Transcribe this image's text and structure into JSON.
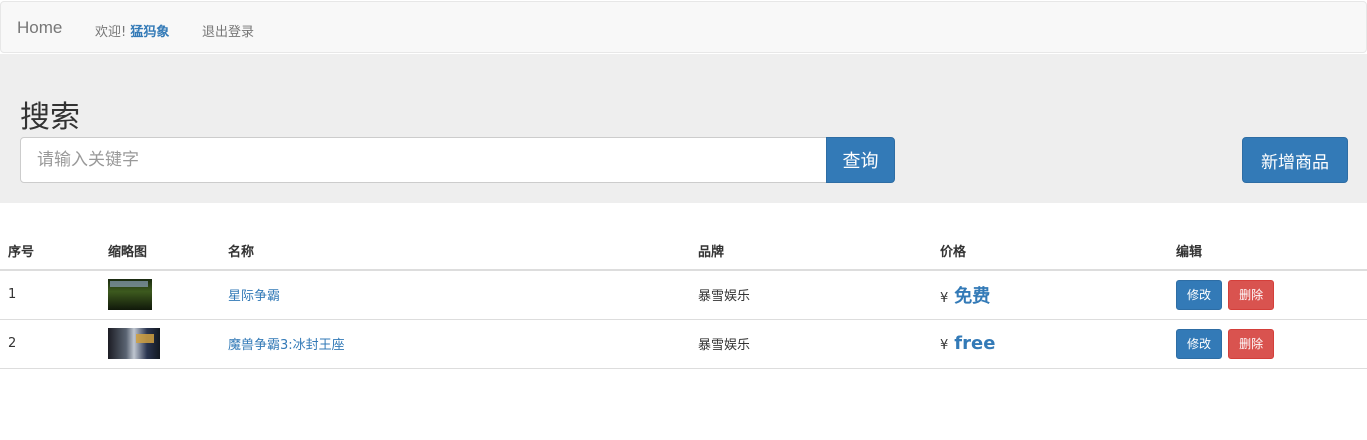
{
  "nav": {
    "brand": "Home",
    "welcome_prefix": "欢迎!",
    "username": "猛犸象",
    "logout": "退出登录"
  },
  "search": {
    "heading": "搜索",
    "placeholder": "请输入关键字",
    "value": "",
    "submit_label": "查询",
    "add_label": "新增商品"
  },
  "table": {
    "headers": [
      "序号",
      "缩略图",
      "名称",
      "品牌",
      "价格",
      "编辑"
    ],
    "currency_symbol": "¥",
    "edit_label": "修改",
    "delete_label": "删除",
    "rows": [
      {
        "index": "1",
        "thumb_icon": "starcraft-thumbnail",
        "name": "星际争霸",
        "brand": "暴雪娱乐",
        "price": "免费"
      },
      {
        "index": "2",
        "thumb_icon": "warcraft3-thumbnail",
        "name": "魔兽争霸3:冰封王座",
        "brand": "暴雪娱乐",
        "price": "free"
      }
    ]
  },
  "colors": {
    "primary": "#337ab7",
    "danger": "#d9534f",
    "jumbotron_bg": "#eeeeee",
    "navbar_bg": "#f8f8f8"
  }
}
